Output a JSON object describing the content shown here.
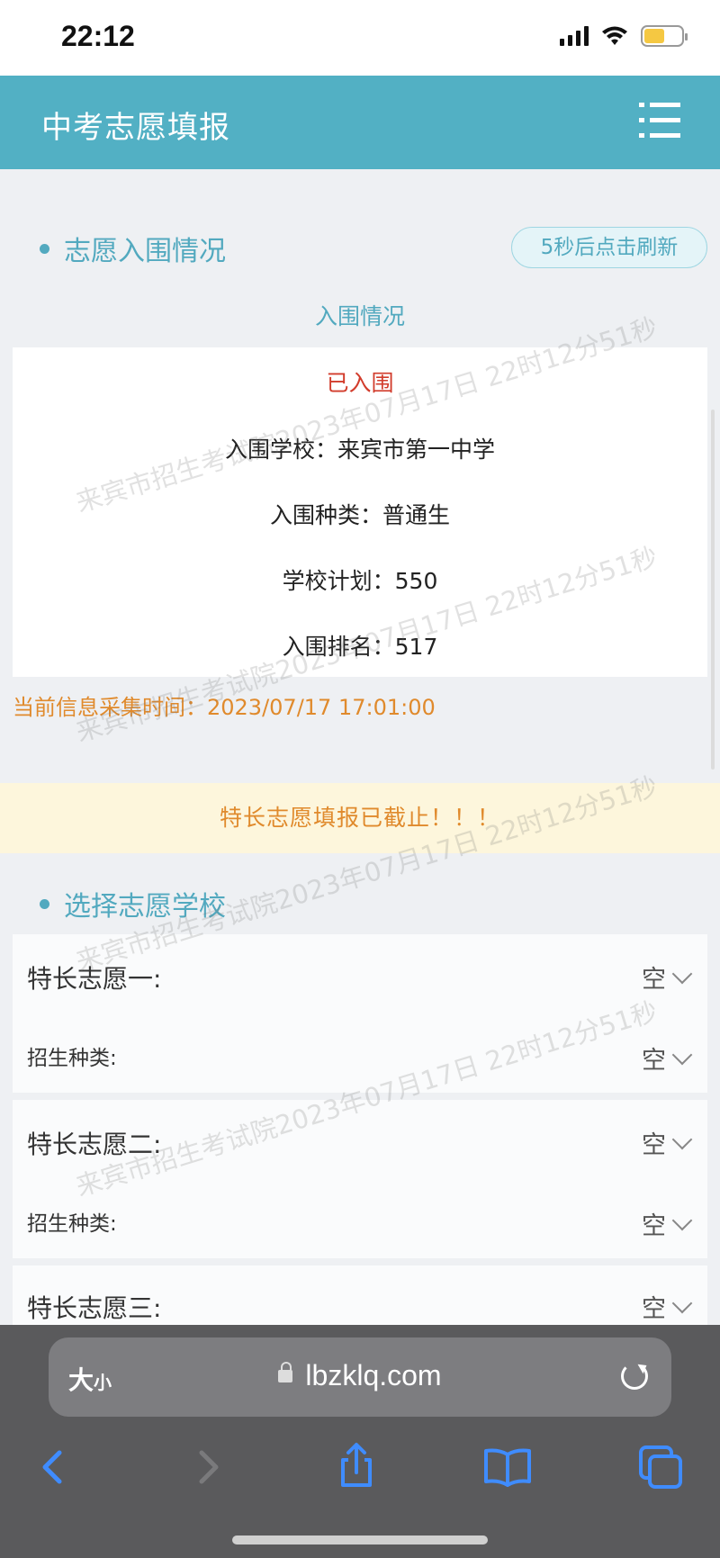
{
  "status_bar": {
    "time": "22:12"
  },
  "header": {
    "title": "中考志愿填报"
  },
  "admission": {
    "section_title": "志愿入围情况",
    "refresh_button": "5秒后点击刷新",
    "subtitle": "入围情况",
    "status": "已入围",
    "school_line": "入围学校：来宾市第一中学",
    "type_line": "入围种类：普通生",
    "plan_line": "学校计划：550",
    "rank_line": "入围排名：517",
    "collect_time": "当前信息采集时间：2023/07/17 17:01:00"
  },
  "deadline_notice": "特长志愿填报已截止！！！",
  "choices": {
    "section_title": "选择志愿学校",
    "items": [
      {
        "label": "特长志愿一:",
        "value": "空",
        "sub_label": "招生种类:",
        "sub_value": "空"
      },
      {
        "label": "特长志愿二:",
        "value": "空",
        "sub_label": "招生种类:",
        "sub_value": "空"
      },
      {
        "label": "特长志愿三:",
        "value": "空"
      }
    ]
  },
  "watermark": {
    "line1": "来宾市招生考试院2023年07月17日 22时12分51秒"
  },
  "browser": {
    "text_size_big": "大",
    "text_size_small": "小",
    "url": "lbzklq.com"
  },
  "colors": {
    "accent": "#52b0c4",
    "admitted": "#d23c2c",
    "warning": "#e08a2c",
    "ios_blue": "#3f8cff"
  },
  "icons": [
    "menu-list-icon",
    "lock-icon",
    "reload-icon",
    "back-icon",
    "forward-icon",
    "share-icon",
    "bookmarks-icon",
    "tabs-icon",
    "chevron-down-icon"
  ]
}
